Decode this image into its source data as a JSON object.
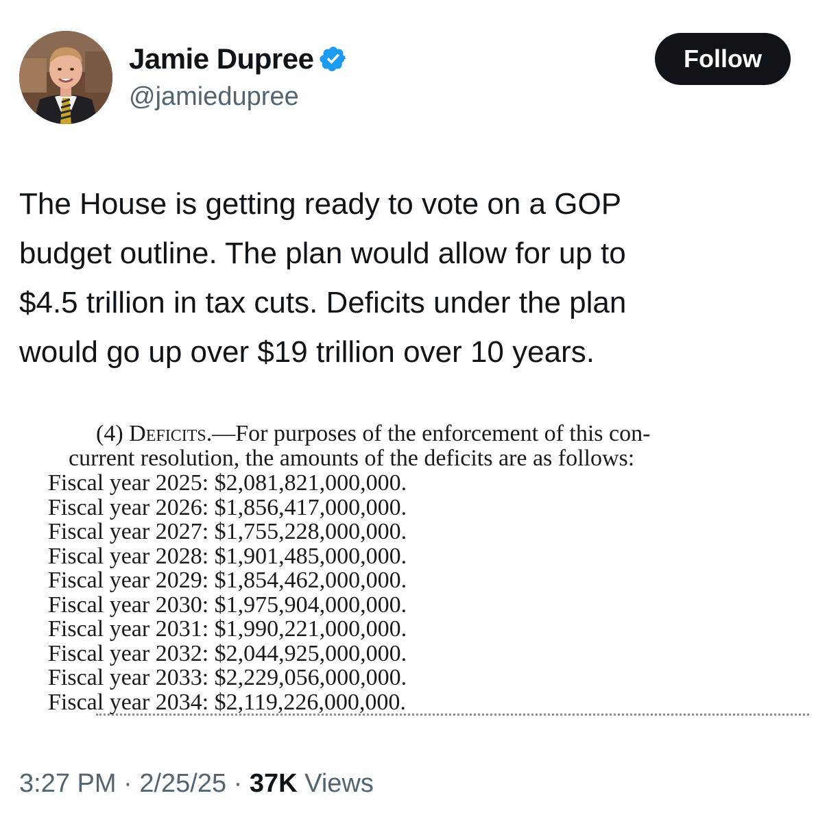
{
  "tweet": {
    "author": {
      "name": "Jamie Dupree",
      "handle": "@jamiedupree",
      "verified_color": "#1d9bf0"
    },
    "follow_label": "Follow",
    "text": "The House is getting ready to vote on a GOP\nbudget outline.  The plan would allow for up to\n$4.5 trillion in tax cuts.  Deficits under the plan\nwould go up over $19 trillion over 10 years.",
    "document": {
      "section_number": "(4)",
      "section_title": "Deficits.",
      "intro_line1_rest": "—For purposes of the enforcement of this con-",
      "intro_line2": "current resolution, the amounts of the deficits are as follows:",
      "rows": [
        "Fiscal year 2025: $2,081,821,000,000.",
        "Fiscal year 2026: $1,856,417,000,000.",
        "Fiscal year 2027: $1,755,228,000,000.",
        "Fiscal year 2028: $1,901,485,000,000.",
        "Fiscal year 2029: $1,854,462,000,000.",
        "Fiscal year 2030: $1,975,904,000,000.",
        "Fiscal year 2031: $1,990,221,000,000.",
        "Fiscal year 2032: $2,044,925,000,000.",
        "Fiscal year 2033: $2,229,056,000,000.",
        "Fiscal year 2034: $2,119,226,000,000."
      ]
    },
    "meta": {
      "time": "3:27 PM",
      "separator": "·",
      "date": "2/25/25",
      "views_count": "37K",
      "views_label": "Views"
    }
  }
}
